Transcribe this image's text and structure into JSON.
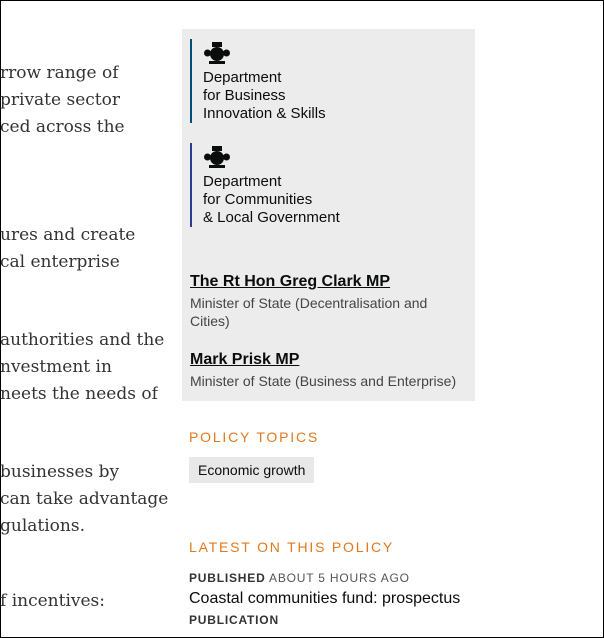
{
  "body_text": [
    "rrow range of",
    " private sector",
    "ced across the",
    "ures and create",
    "cal enterprise",
    "authorities and the",
    "nvestment in",
    "neets the needs of",
    " businesses by",
    "can take advantage",
    "gulations.",
    "f incentives:"
  ],
  "organisations": [
    {
      "lines": [
        "Department",
        "for Business",
        "Innovation & Skills"
      ],
      "color": "#00507a"
    },
    {
      "lines": [
        "Department",
        "for Communities",
        "& Local Government"
      ],
      "color": "#2b3d8c"
    }
  ],
  "ministers": [
    {
      "name": "The Rt Hon Greg Clark MP",
      "role": "Minister of State (Decentralisation and Cities)"
    },
    {
      "name": "Mark Prisk MP",
      "role": "Minister of State (Business and Enterprise)"
    }
  ],
  "policy_topics": {
    "heading": "POLICY TOPICS",
    "tags": [
      "Economic growth"
    ]
  },
  "latest": {
    "heading": "LATEST ON THIS POLICY",
    "published_label": "PUBLISHED",
    "published_time": "ABOUT 5 HOURS AGO",
    "title": "Coastal communities fund: prospectus",
    "type": "PUBLICATION"
  },
  "colors": {
    "accent_heading": "#e07a1e",
    "panel_bg": "#ececec"
  },
  "icons": [
    "royal-crest-icon"
  ]
}
